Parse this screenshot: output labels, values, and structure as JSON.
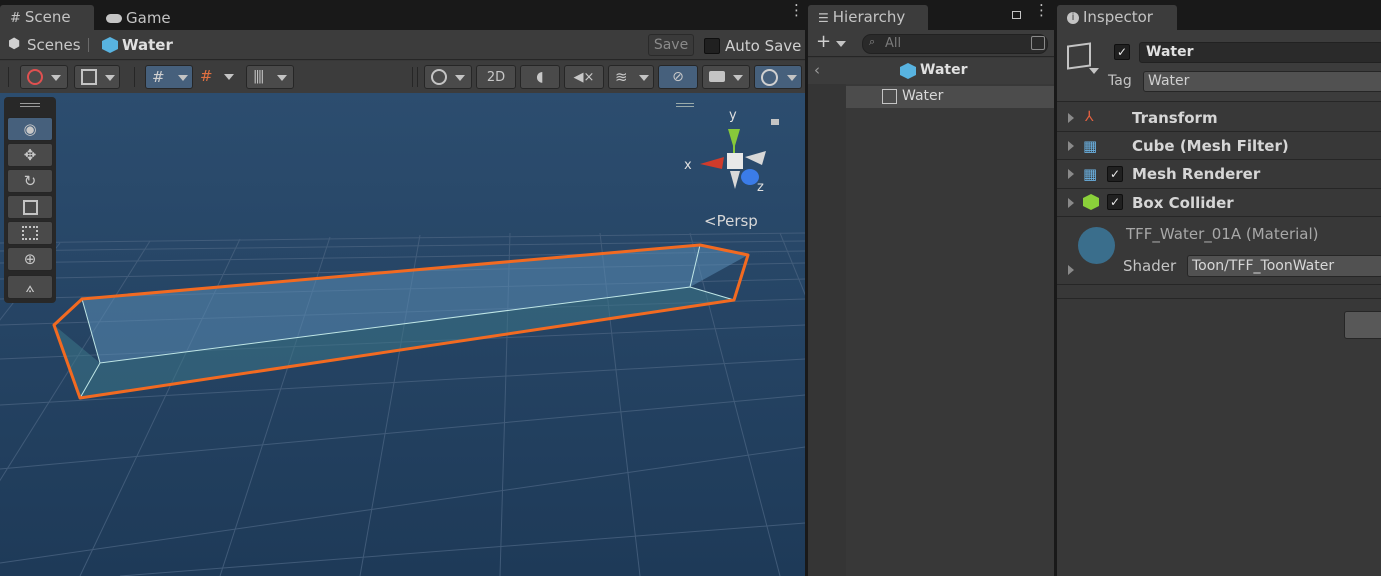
{
  "scene_tabs": {
    "scene": "Scene",
    "game": "Game"
  },
  "breadcrumb": {
    "root": "Scenes",
    "object": "Water"
  },
  "save": {
    "save_label": "Save",
    "auto_save_label": "Auto Save"
  },
  "toolbar": {
    "mode_2d": "2D"
  },
  "viewport": {
    "axis_x": "x",
    "axis_y": "y",
    "axis_z": "z",
    "projection": "Persp",
    "colors": {
      "sky": "#2c4d6f",
      "ground": "#1d3550",
      "selection": "#f26a21",
      "axis_x": "#d13b2b",
      "axis_y": "#86c83a",
      "axis_z": "#3b7ce8"
    }
  },
  "hierarchy": {
    "tab": "Hierarchy",
    "search_placeholder": "All",
    "scene_name": "Water",
    "items": [
      {
        "label": "Water"
      }
    ]
  },
  "inspector": {
    "tab": "Inspector",
    "object_name": "Water",
    "tag_label": "Tag",
    "tag_value": "Water",
    "components": [
      {
        "label": "Transform"
      },
      {
        "label": "Cube (Mesh Filter)"
      },
      {
        "label": "Mesh Renderer"
      },
      {
        "label": "Box Collider"
      }
    ],
    "material": {
      "name": "TFF_Water_01A (Material)",
      "shader_label": "Shader",
      "shader_value": "Toon/TFF_ToonWater",
      "color": "#3a6e8c"
    }
  }
}
